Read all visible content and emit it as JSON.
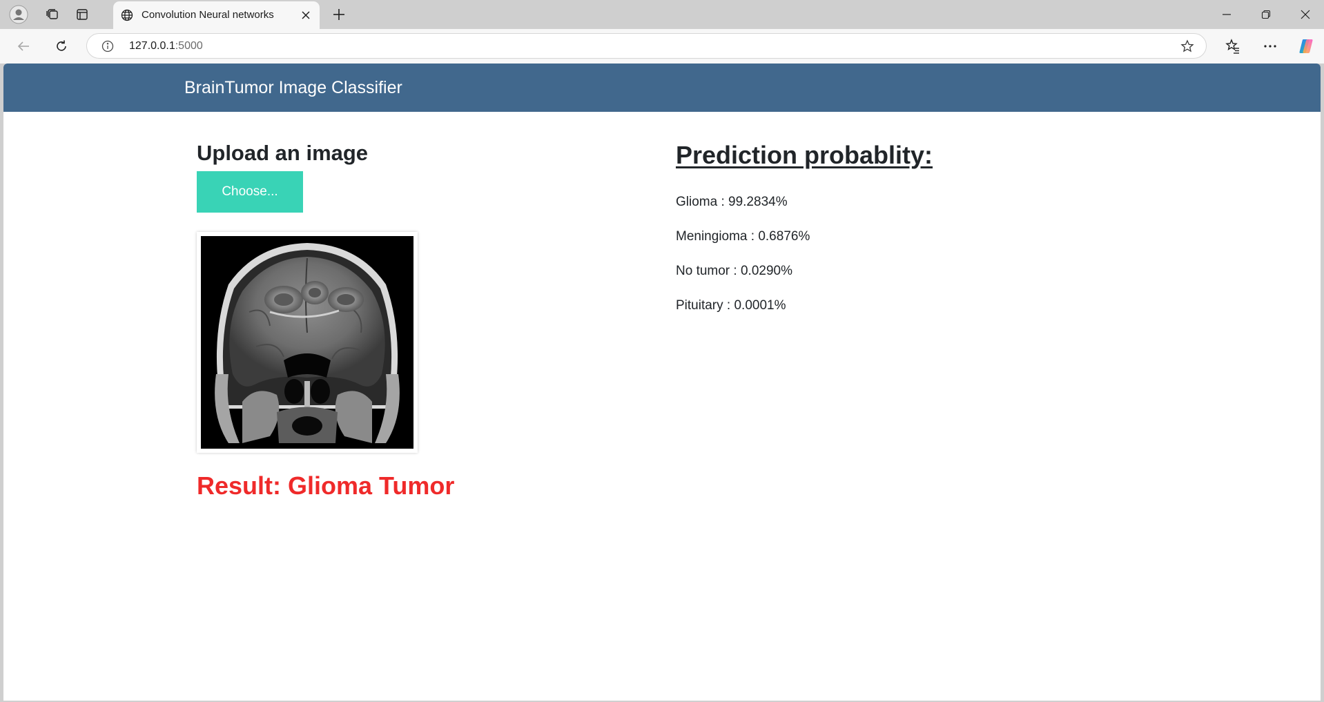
{
  "browser": {
    "tab_title": "Convolution Neural networks",
    "url_host": "127.0.0.1",
    "url_port": ":5000",
    "icons": [
      "profile-icon",
      "collections-icon",
      "tab-actions-icon",
      "globe-icon",
      "close-icon",
      "plus-icon",
      "minimize-icon",
      "restore-icon",
      "window-close-icon",
      "back-arrow-icon",
      "refresh-icon",
      "info-icon",
      "star-icon",
      "favorites-icon",
      "more-icon",
      "copilot-icon"
    ]
  },
  "app": {
    "brand": "BrainTumor Image Classifier"
  },
  "upload": {
    "title": "Upload an image",
    "button_label": "Choose..."
  },
  "result": {
    "text": "Result: Glioma Tumor"
  },
  "prediction": {
    "title": "Prediction probablity:",
    "items": [
      "Glioma : 99.2834%",
      "Meningioma : 0.6876%",
      "No tumor : 0.0290%",
      "Pituitary : 0.0001%"
    ]
  },
  "colors": {
    "navbar": "#41688d",
    "button": "#39d3b6",
    "result": "#ef2a2a"
  }
}
